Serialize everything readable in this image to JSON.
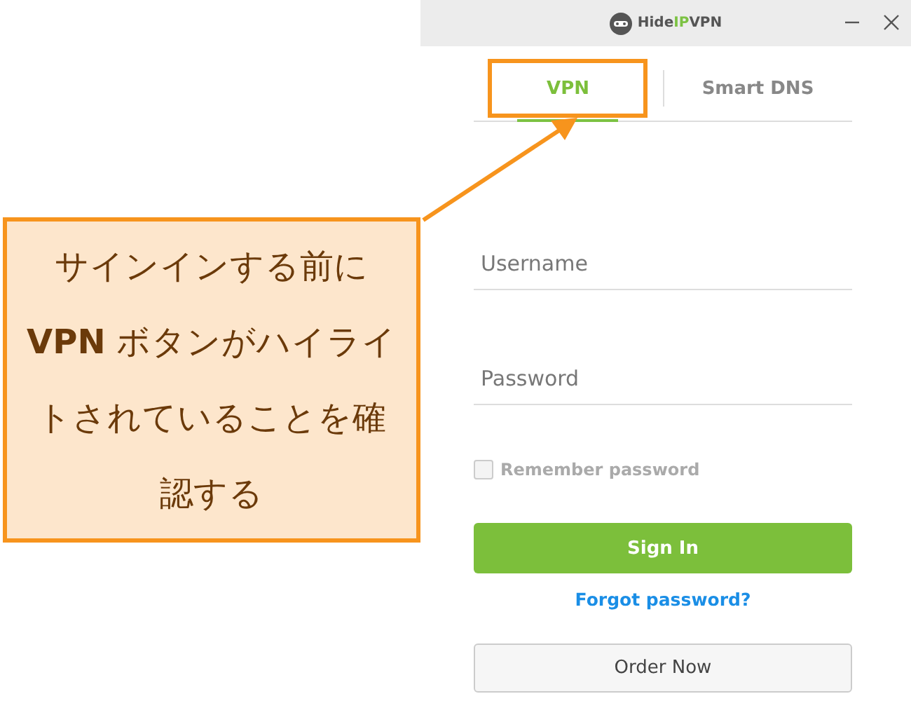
{
  "window": {
    "logo": {
      "before": "Hide",
      "accent": "IP",
      "after": "VPN"
    }
  },
  "tabs": [
    {
      "label": "VPN",
      "selected": true,
      "highlighted": true
    },
    {
      "label": "Smart DNS",
      "selected": false,
      "highlighted": false
    }
  ],
  "username": {
    "placeholder": "Username"
  },
  "password": {
    "placeholder": "Password"
  },
  "remember": {
    "label": "Remember password",
    "checked": false
  },
  "sign_in": {
    "label": "Sign In"
  },
  "forgot": {
    "label": "Forgot password?"
  },
  "order": {
    "label": "Order Now"
  },
  "annotation": {
    "lines": [
      "サインインする前に",
      "**VPN** ボタンがハイライ",
      "トされていることを確",
      "認する"
    ]
  }
}
